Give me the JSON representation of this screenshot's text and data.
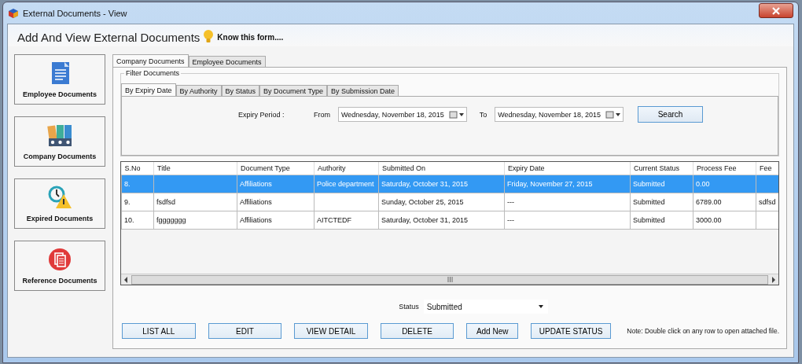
{
  "window": {
    "title": "External Documents - View"
  },
  "header": {
    "title": "Add And View External Documents",
    "help_link": "Know this form...."
  },
  "sidebar": {
    "items": [
      {
        "label": "Employee Documents"
      },
      {
        "label": "Company Documents"
      },
      {
        "label": "Expired Documents"
      },
      {
        "label": "Reference Documents"
      }
    ]
  },
  "tabs": [
    {
      "label": "Company Documents",
      "selected": true
    },
    {
      "label": "Employee Documents",
      "selected": false
    }
  ],
  "filter": {
    "legend": "Filter Documents",
    "tabs": [
      {
        "label": "By Expiry Date",
        "selected": true
      },
      {
        "label": "By Authority",
        "selected": false
      },
      {
        "label": "By Status",
        "selected": false
      },
      {
        "label": "By Document Type",
        "selected": false
      },
      {
        "label": "By Submission Date",
        "selected": false
      }
    ],
    "period_label": "Expiry Period :",
    "from_label": "From",
    "from_value": "Wednesday, November 18, 2015",
    "to_label": "To",
    "to_value": "Wednesday, November 18, 2015",
    "search_button": "Search"
  },
  "table": {
    "columns": [
      "S.No",
      "Title",
      "Document Type",
      "Authority",
      "Submitted On",
      "Expiry Date",
      "Current Status",
      "Process Fee",
      "Fee"
    ],
    "rows": [
      {
        "selected": true,
        "cells": [
          "8.",
          "",
          "Affiliations",
          "Police department",
          "Saturday, October 31, 2015",
          "Friday, November 27, 2015",
          "Submitted",
          "0.00",
          ""
        ]
      },
      {
        "selected": false,
        "cells": [
          "9.",
          "fsdfsd",
          "Affiliations",
          "",
          "Sunday, October 25, 2015",
          "---",
          "Submitted",
          "6789.00",
          "sdfsd"
        ]
      },
      {
        "selected": false,
        "cells": [
          "10.",
          "fggggggg",
          "Affiliations",
          "AITCTEDF",
          "Saturday, October 31, 2015",
          "---",
          "Submitted",
          "3000.00",
          ""
        ]
      }
    ]
  },
  "status_field": {
    "label": "Status",
    "value": "Submitted"
  },
  "buttons": [
    "LIST ALL",
    "EDIT",
    "VIEW DETAIL",
    "DELETE",
    "Add New",
    "UPDATE STATUS"
  ],
  "note": "Note: Double click on any row to open attached file."
}
